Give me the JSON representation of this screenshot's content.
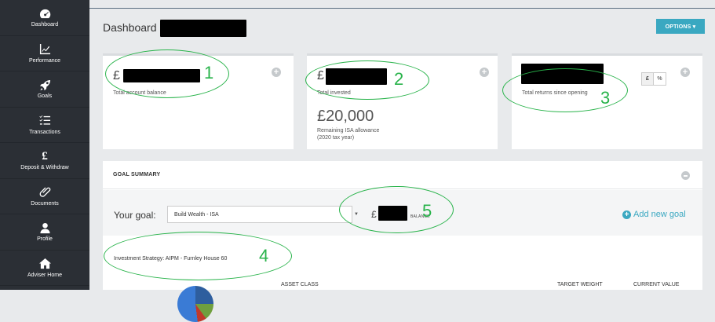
{
  "sidebar": {
    "items": [
      {
        "label": "Dashboard",
        "icon": "dashboard-icon"
      },
      {
        "label": "Performance",
        "icon": "chart-icon"
      },
      {
        "label": "Goals",
        "icon": "rocket-icon"
      },
      {
        "label": "Transactions",
        "icon": "list-icon"
      },
      {
        "label": "Deposit & Withdraw",
        "icon": "pound-icon"
      },
      {
        "label": "Documents",
        "icon": "paperclip-icon"
      },
      {
        "label": "Profile",
        "icon": "user-icon"
      },
      {
        "label": "Adviser Home",
        "icon": "home-icon"
      }
    ]
  },
  "header": {
    "title": "Dashboard -",
    "options_label": "OPTIONS ▾"
  },
  "cards": {
    "account_balance": {
      "amount_prefix": "£",
      "label": "Total account balance"
    },
    "total_invested": {
      "amount_prefix": "£",
      "label": "Total invested",
      "isa_amount": "£20,000",
      "isa_label": "Remaining ISA allowance",
      "isa_sublabel": "(2020 tax year)"
    },
    "total_returns": {
      "label": "Total returns since opening",
      "toggle_pound": "£",
      "toggle_percent": "%"
    }
  },
  "goal_summary": {
    "title": "GOAL SUMMARY",
    "your_goal_label": "Your goal:",
    "selected_goal": "Build Wealth - ISA",
    "balance_prefix": "£",
    "balance_label": "BALANCE",
    "add_goal_label": "Add new goal",
    "strategy": "Investment Strategy: AIPM - Furnley House 60",
    "columns": [
      "ASSET CLASS",
      "TARGET WEIGHT",
      "CURRENT VALUE"
    ]
  },
  "annotations": [
    "1",
    "2",
    "3",
    "4",
    "5"
  ],
  "colors": {
    "sidebar_bg": "#2b2f35",
    "accent": "#3aa8c1",
    "annotation": "#28b34a"
  }
}
